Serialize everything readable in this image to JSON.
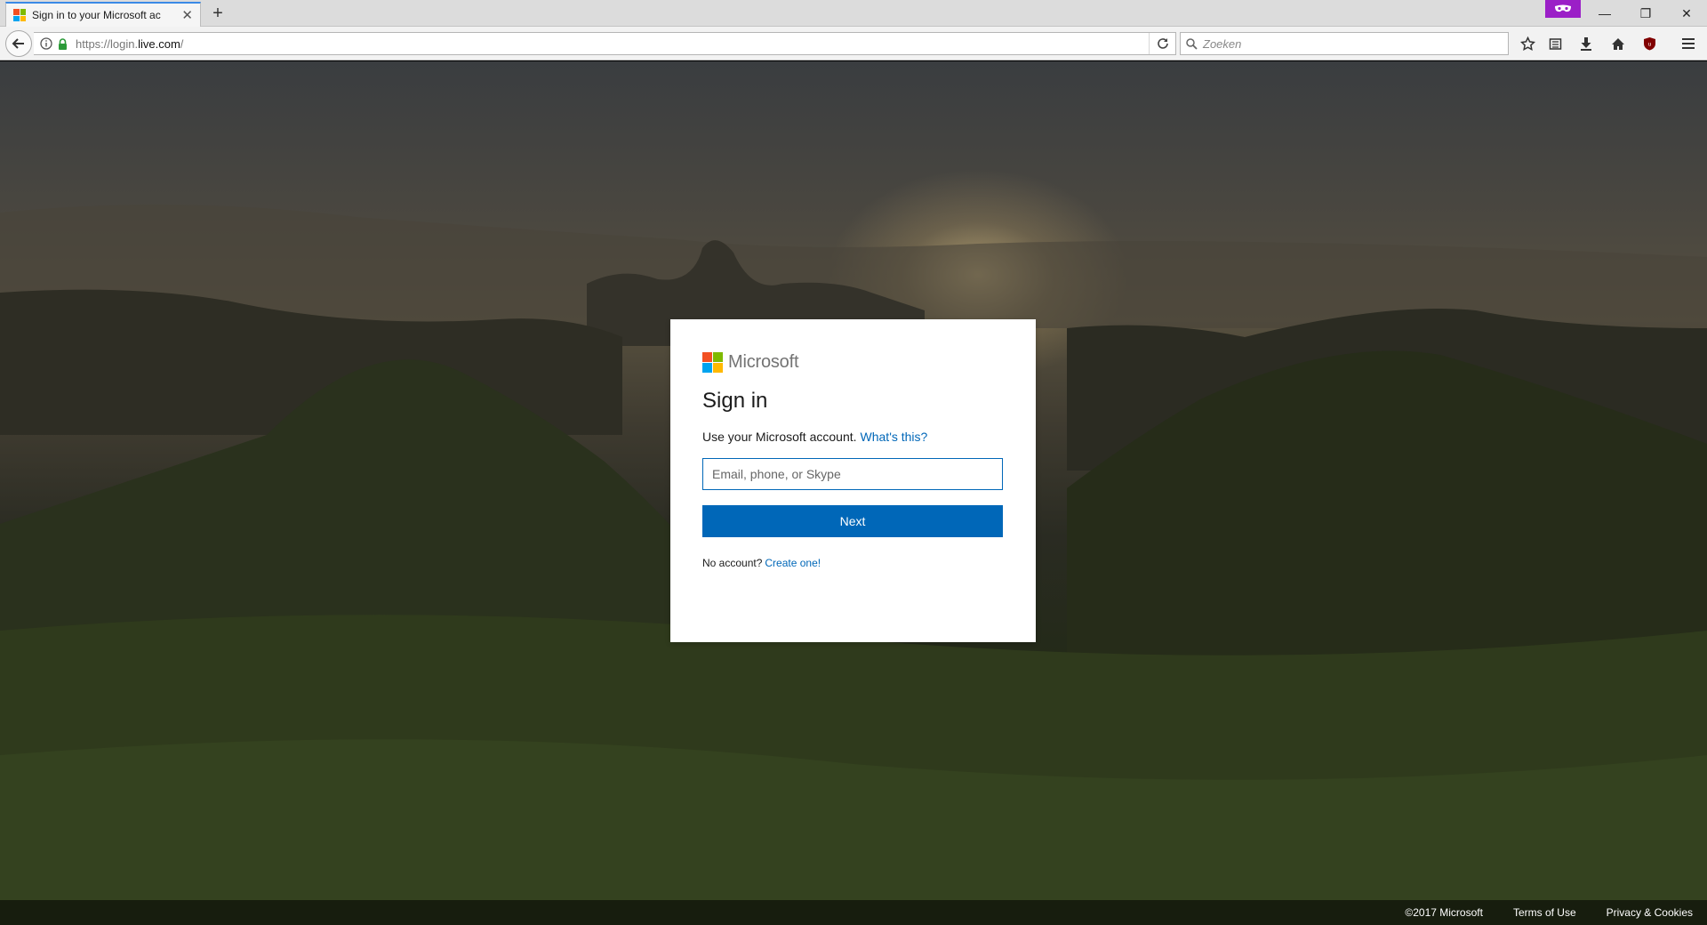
{
  "browser": {
    "tab": {
      "title": "Sign in to your Microsoft ac",
      "close_glyph": "✕",
      "favicon": "microsoft-logo-icon"
    },
    "new_tab_glyph": "+",
    "window_controls": {
      "minimize": "—",
      "maximize": "❐",
      "close": "✕"
    },
    "url": {
      "prefix": "https://login.",
      "domain": "live.com",
      "suffix": "/"
    },
    "search_placeholder": "Zoeken",
    "toolbar_icons": [
      "bookmark-star-icon",
      "reading-list-icon",
      "download-icon",
      "home-icon",
      "ublock-icon",
      "menu-icon"
    ],
    "accent_color": "#3b8ae6"
  },
  "signin": {
    "brand": "Microsoft",
    "brand_colors": {
      "red": "#f25022",
      "green": "#7fba00",
      "blue": "#00a4ef",
      "yellow": "#ffb900"
    },
    "title": "Sign in",
    "description": "Use your Microsoft account.",
    "whats_this": "What's this?",
    "email_placeholder": "Email, phone, or Skype",
    "next_label": "Next",
    "no_account": "No account?",
    "create_one": "Create one!",
    "accent_color": "#0067b8"
  },
  "footer": {
    "copyright": "©2017 Microsoft",
    "terms": "Terms of Use",
    "privacy": "Privacy & Cookies"
  }
}
